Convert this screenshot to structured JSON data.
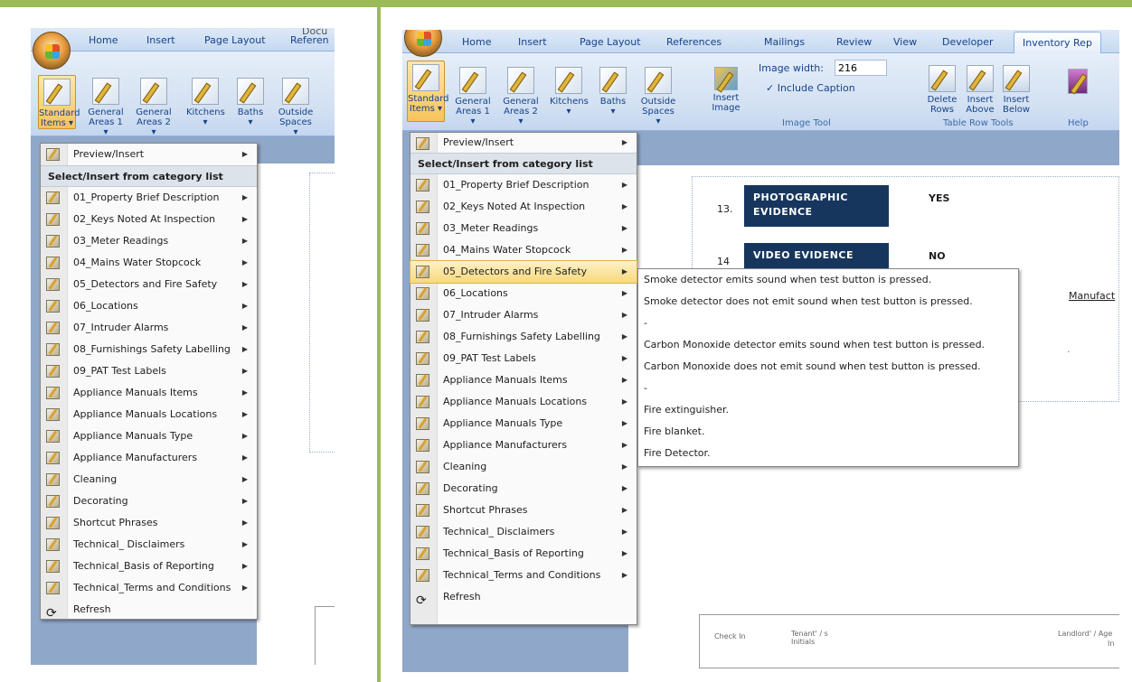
{
  "left": {
    "office_button": "Office",
    "tabs": [
      "Home",
      "Insert",
      "Page Layout",
      "Referen",
      "Docu"
    ],
    "ribbon_buttons": [
      {
        "line1": "Standard",
        "line2": "Items ▾"
      },
      {
        "line1": "General",
        "line2": "Areas 1 ▾"
      },
      {
        "line1": "General",
        "line2": "Areas 2 ▾"
      },
      {
        "line1": "Kitchens",
        "line2": "▾"
      },
      {
        "line1": "Baths",
        "line2": "▾"
      },
      {
        "line1": "Outside",
        "line2": "Spaces ▾"
      }
    ]
  },
  "right": {
    "tabs": [
      "Home",
      "Insert",
      "Page Layout",
      "References",
      "Mailings",
      "Review",
      "View",
      "Developer",
      "Inventory Rep"
    ],
    "ribbon_buttons": [
      {
        "line1": "Standard",
        "line2": "Items ▾"
      },
      {
        "line1": "General",
        "line2": "Areas 1 ▾"
      },
      {
        "line1": "General",
        "line2": "Areas 2 ▾"
      },
      {
        "line1": "Kitchens",
        "line2": "▾"
      },
      {
        "line1": "Baths",
        "line2": "▾"
      },
      {
        "line1": "Outside",
        "line2": "Spaces ▾"
      }
    ],
    "insert_image": {
      "line1": "Insert",
      "line2": "Image"
    },
    "image_tool": {
      "width_label": "Image width:",
      "width_value": "216",
      "caption_label": "Include Caption",
      "group": "Image Tool"
    },
    "table_tools": {
      "delete": {
        "line1": "Delete",
        "line2": "Rows"
      },
      "insert_above": {
        "line1": "Insert",
        "line2": "Above"
      },
      "insert_below": {
        "line1": "Insert",
        "line2": "Below"
      },
      "group": "Table Row Tools"
    },
    "help_group": "Help",
    "table": {
      "row13_num": "13.",
      "row13_header": "PHOTOGRAPHIC EVIDENCE",
      "row13_value": "YES",
      "row14_num": "14",
      "row14_header": "VIDEO EVIDENCE",
      "row14_value": "NO",
      "manufact": "Manufact",
      "dot": "·"
    },
    "footer": {
      "check_in": "Check In",
      "tenant": "Tenant' / s Initials",
      "landlord": "Landlord' / Age",
      "in": "In"
    }
  },
  "menu": {
    "preview": "Preview/Insert",
    "header": "Select/Insert from category list",
    "items": [
      "01_Property Brief Description",
      "02_Keys Noted At Inspection",
      "03_Meter Readings",
      "04_Mains Water Stopcock",
      "05_Detectors and Fire Safety",
      "06_Locations",
      "07_Intruder Alarms",
      "08_Furnishings Safety Labelling",
      "09_PAT Test Labels",
      "Appliance Manuals Items",
      "Appliance Manuals Locations",
      "Appliance Manuals Type",
      "Appliance Manufacturers",
      "Cleaning",
      "Decorating",
      "Shortcut Phrases",
      "Technical_ Disclaimers",
      "Technical_Basis of Reporting",
      "Technical_Terms and Conditions"
    ],
    "refresh": "Refresh"
  },
  "submenu": [
    "Smoke detector emits sound when test button is pressed.",
    "Smoke detector does not emit sound when test button is pressed.",
    "-",
    "Carbon Monoxide detector emits sound when test button is pressed.",
    "Carbon Monoxide does not emit sound when test button is pressed.",
    "-",
    "Fire extinguisher.",
    "Fire blanket.",
    "Fire Detector."
  ],
  "colors": {
    "frame": "#9bbb59",
    "highlight": "#f9d97c",
    "table_header": "#17365d",
    "ribbon_text": "#15428b"
  }
}
